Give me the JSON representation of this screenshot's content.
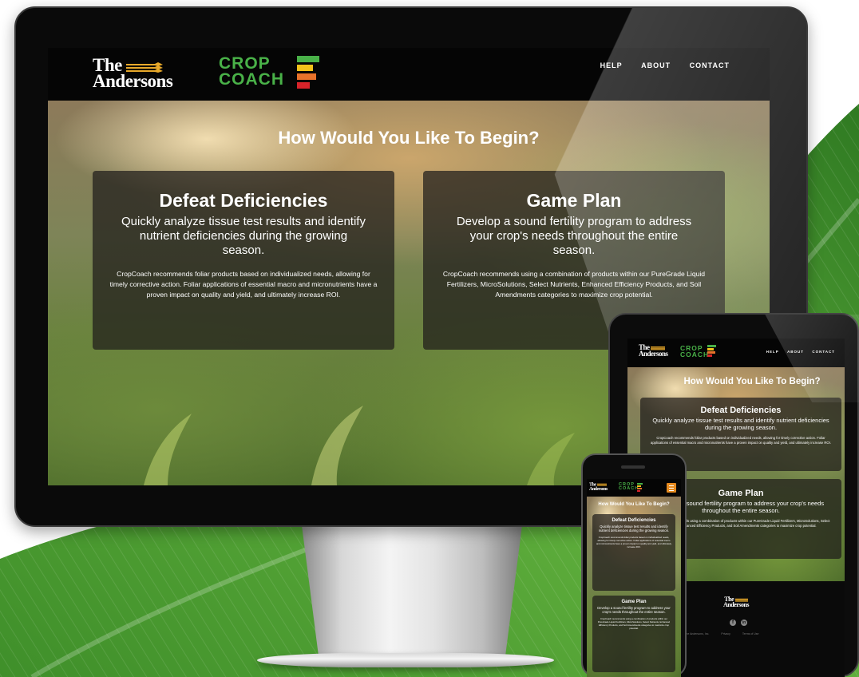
{
  "site": {
    "brand_line1": "The",
    "brand_line2": "Andersons",
    "crop_line1": "CROP",
    "crop_line2": "COACH",
    "nav": [
      "HELP",
      "ABOUT",
      "CONTACT"
    ],
    "headline": "How Would You Like To Begin?",
    "cards": [
      {
        "title": "Defeat Deficiencies",
        "subtitle": "Quickly analyze tissue test results and identify nutrient deficiencies during the growing season.",
        "body": "CropCoach recommends foliar products based on individualized needs, allowing for timely corrective action. Foliar applications of essential macro and micronutrients have a proven impact on quality and yield, and ultimately increase ROI."
      },
      {
        "title": "Game Plan",
        "subtitle": "Develop a sound fertility program to address your crop's needs throughout the entire season.",
        "body": "CropCoach recommends using a combination of products within our PureGrade Liquid Fertilizers, MicroSolutions, Select Nutrients, Enhanced Efficiency Products, and Soil Amendments categories to maximize crop potential."
      }
    ],
    "footer": {
      "copyright": "©2018 The Andersons, Inc.",
      "privacy": "Privacy",
      "terms": "Terms of Use"
    }
  },
  "colors": {
    "crop_green": "#49b148",
    "bar_yellow": "#f2c21b",
    "bar_orange": "#e8722a",
    "bar_red": "#d8232a",
    "wheat_gold": "#e8a92a",
    "menu_orange": "#e58a1f"
  },
  "icons": {
    "facebook": "facebook-icon",
    "linkedin": "linkedin-icon",
    "menu": "hamburger-menu-icon"
  }
}
